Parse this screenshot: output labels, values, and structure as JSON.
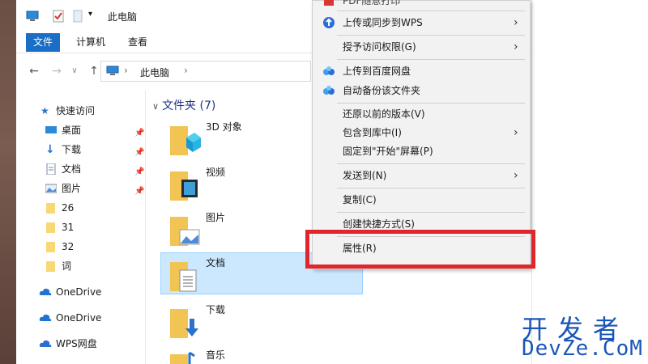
{
  "window": {
    "title": "此电脑"
  },
  "ribbon": {
    "tabs": [
      "文件",
      "计算机",
      "查看"
    ]
  },
  "address": {
    "path": "此电脑",
    "separator": "›"
  },
  "nav": {
    "quick_access": "快速访问",
    "items": [
      "桌面",
      "下载",
      "文档",
      "图片",
      "26",
      "31",
      "32",
      "词"
    ],
    "onedrive1": "OneDrive",
    "onedrive2": "OneDrive",
    "wps": "WPS网盘"
  },
  "content": {
    "group_title": "文件夹 (7)",
    "files": [
      "3D 对象",
      "视频",
      "图片",
      "文档",
      "下载",
      "音乐"
    ]
  },
  "context_menu": {
    "top_partial": "PDF随意打印",
    "items": [
      {
        "label": "上传或同步到WPS",
        "submenu": true,
        "icon": "wps-cloud-icon"
      },
      {
        "label": "授予访问权限(G)",
        "submenu": true
      },
      {
        "label": "上传到百度网盘",
        "icon": "baidu-cloud-icon"
      },
      {
        "label": "自动备份该文件夹",
        "icon": "baidu-cloud-icon"
      },
      {
        "label": "还原以前的版本(V)"
      },
      {
        "label": "包含到库中(I)",
        "submenu": true
      },
      {
        "label": "固定到\"开始\"屏幕(P)"
      },
      {
        "label": "发送到(N)",
        "submenu": true
      },
      {
        "label": "复制(C)"
      },
      {
        "label": "创建快捷方式(S)"
      },
      {
        "label": "属性(R)"
      }
    ]
  },
  "watermark": {
    "cn": "开发者",
    "en": "DevZe.CoM"
  },
  "colors": {
    "accent": "#1a6ec6",
    "highlight": "#e0262b",
    "selection": "#cce8ff",
    "watermark": "#1a56b8"
  }
}
